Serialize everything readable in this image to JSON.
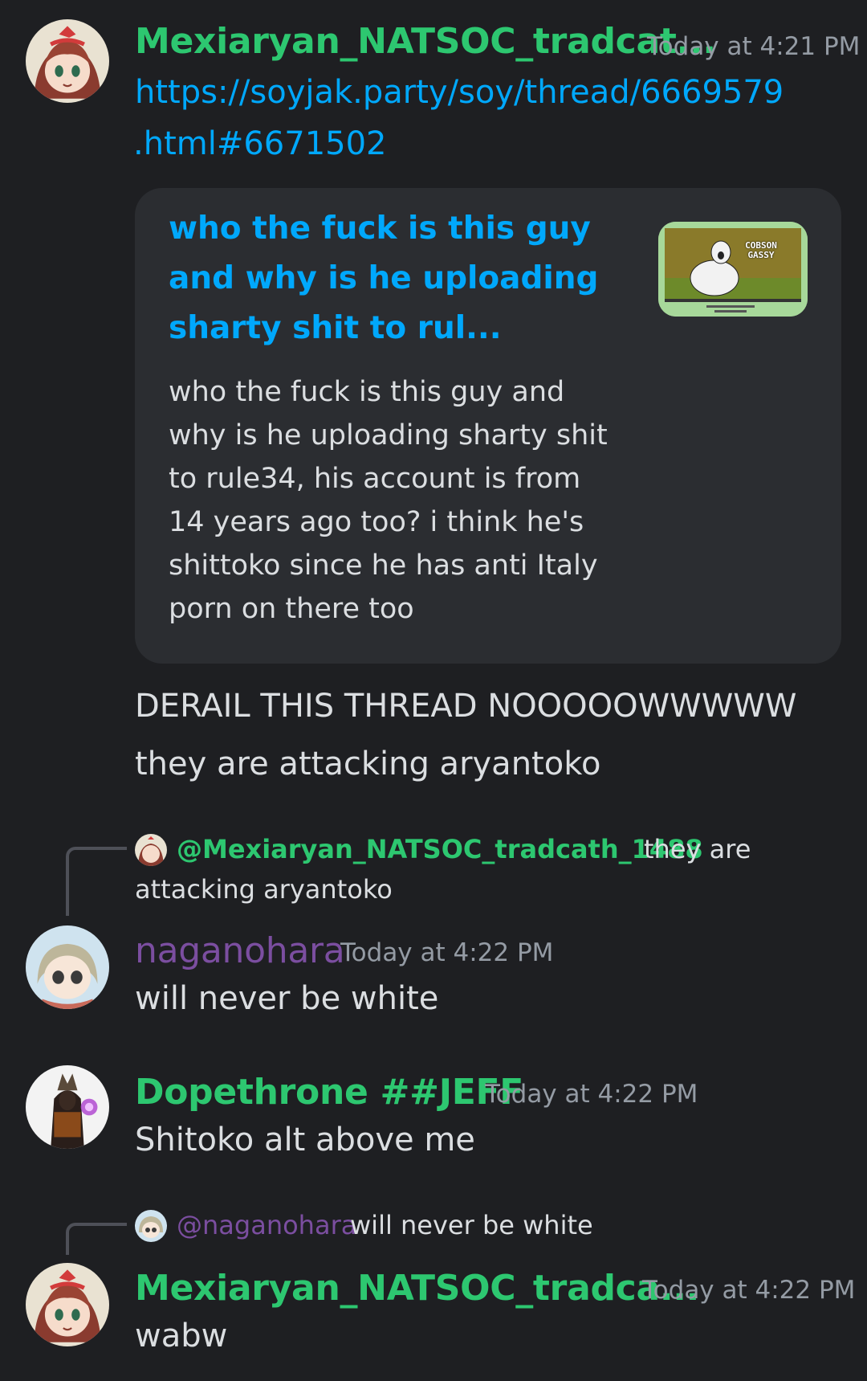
{
  "colors": {
    "background": "#1e1f22",
    "embed_bg": "#2b2d31",
    "link": "#00a8fc",
    "green_name": "#2dc770",
    "purple_name": "#7b4ea0",
    "timestamp": "#949ba4"
  },
  "messages": [
    {
      "author": "Mexiaryan_NATSOC_tradcat...",
      "timestamp": "Today at 4:21 PM",
      "avatar_icon": "anime-girl-avatar",
      "link_line1": "https://soyjak.party/soy/thread/6669579",
      "link_line2": ".html#6671502",
      "embed": {
        "title_lines": [
          "who the fuck is this guy",
          "and why is he uploading",
          "sharty shit to rul..."
        ],
        "description_lines": [
          "who the fuck is this guy and",
          "why is he uploading sharty shit",
          "to rule34, his account is from",
          "14 years ago too? i think he's",
          "shittoko since he has anti Italy",
          "porn on there too"
        ],
        "thumbnail_text": "COBSON GASSY"
      },
      "followups": [
        "DERAIL THIS THREAD NOOOOOWWWWW",
        "they are attacking aryantoko"
      ]
    },
    {
      "reply_to": {
        "name": "@Mexiaryan_NATSOC_tradcath_1488",
        "text_line1": "they are",
        "text_line2": "attacking aryantoko"
      },
      "author": "naganohara",
      "timestamp": "Today at 4:22 PM",
      "avatar_icon": "anime-girl-pale-avatar",
      "text": "will never be white"
    },
    {
      "author": "Dopethrone ##JEFF",
      "timestamp": "Today at 4:22 PM",
      "avatar_icon": "dark-warrior-avatar",
      "text": "Shitoko alt above me"
    },
    {
      "reply_to": {
        "name": "@naganohara",
        "text_line1": "will never be white"
      },
      "author": "Mexiaryan_NATSOC_tradca...",
      "timestamp": "Today at 4:22 PM",
      "avatar_icon": "anime-girl-avatar",
      "text": "wabw"
    }
  ]
}
